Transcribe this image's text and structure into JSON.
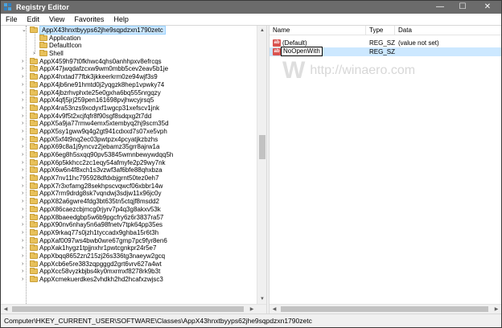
{
  "window": {
    "title": "Registry Editor",
    "minimize": "—",
    "maximize": "☐",
    "close": "✕"
  },
  "menu": [
    "File",
    "Edit",
    "View",
    "Favorites",
    "Help"
  ],
  "tree": {
    "selected": "AppX43hnxtbyyps62jhe9sqpdzxn1790zetc",
    "children": [
      "Application",
      "DefaultIcon",
      "Shell"
    ],
    "siblings": [
      "AppX459h97t0fkhwc4qhs0anhhpxv8efrcqs",
      "AppX47jwqdafzcxw9wm0mbb5cev2eav5b1je",
      "AppX4hxtad77fbk3jkkeerkrm0ze94wjf3s9",
      "AppX4jb6ne91hmtd0j2yqgzk8hep1vpwky74",
      "AppX4jbzrhvphxte25e0gxha6bq555nrgqzy",
      "AppX4qfj5jrj259pen161698pvjhwcyjrsq5",
      "AppX4ra53nzs9xcdyxf1wgcp31xefscv1jnk",
      "AppX4v9f5t2xcjfqfr8f90sgf8sdqxg2t7dd",
      "AppX5a9ja77rmw4emx5xtembyq2hj9scm35d",
      "AppX5sy1gww9q4g2gt941cdxxd7s07xe5vph",
      "AppX5xf4t9nq2ec03pwtpzx4pcyatjkzbzhs",
      "AppX69c8a1j9yncvz2jebamz35grr8ajrw1a",
      "AppX6eg8h5sxqq90pv53845wmnbewywdqq5h",
      "AppX6p5kkhcc2zc1eqy54afmyfe2p29wy7nk",
      "AppX6w6n4f8xch1s3vzwf3af6bfe88qhxbza",
      "AppX7nv11hc795928dfdxbjgrnt50tez0eh7",
      "AppX7r3xrfamg28sekhpscvqwcf06xbbr14w",
      "AppX7rm9drdg8sk7vqndwj3sdjw11x96jc0y",
      "AppX82a6gwre4fdg3bt635tn5ctqjf8msdd2",
      "AppX86caezcbjmcg0rjyrv7p4q3g8akxv53k",
      "AppX8baeedgbp5w6b9pgcfry6z6r3837ra57",
      "AppX90nv6nhay5n6a98fnetv7tpk64pp35es",
      "AppX9rkaq77s0jzh1tyccadx9ghba15r6t3h",
      "AppXaf0097ws4bwb0wre67gmp7pc9fyr8en6",
      "AppXak1hygz1tpjjnxhr1pwtcgnkpr24r5e7",
      "AppXbqq8652zn215zj26s336tg3naeyw2gcq",
      "AppXcb6e5re383zqpgggd2grt6vrv627a4wt",
      "AppXcc58vyzkbjbs4ky0mxrmxf8278rk9b3t",
      "AppXcmekuerdkes2vhdkh2hd2hcafxzwjsc3"
    ]
  },
  "values": {
    "columns": {
      "name": "Name",
      "type": "Type",
      "data": "Data"
    },
    "rows": [
      {
        "name": "(Default)",
        "type": "REG_SZ",
        "data": "(value not set)",
        "icon": "ab"
      },
      {
        "name": "NoOpenWith",
        "type": "REG_SZ",
        "data": "",
        "icon": "ab"
      }
    ],
    "watermark": "http://winaero.com",
    "watermark_logo": "W"
  },
  "statusbar": "Computer\\HKEY_CURRENT_USER\\SOFTWARE\\Classes\\AppX43hnxtbyyps62jhe9sqpdzxn1790zetc",
  "colors": {
    "titlebar": "#6b6b6b",
    "selection": "#cce8ff",
    "folder": "#e8c15a",
    "string_icon": "#d9534f"
  }
}
